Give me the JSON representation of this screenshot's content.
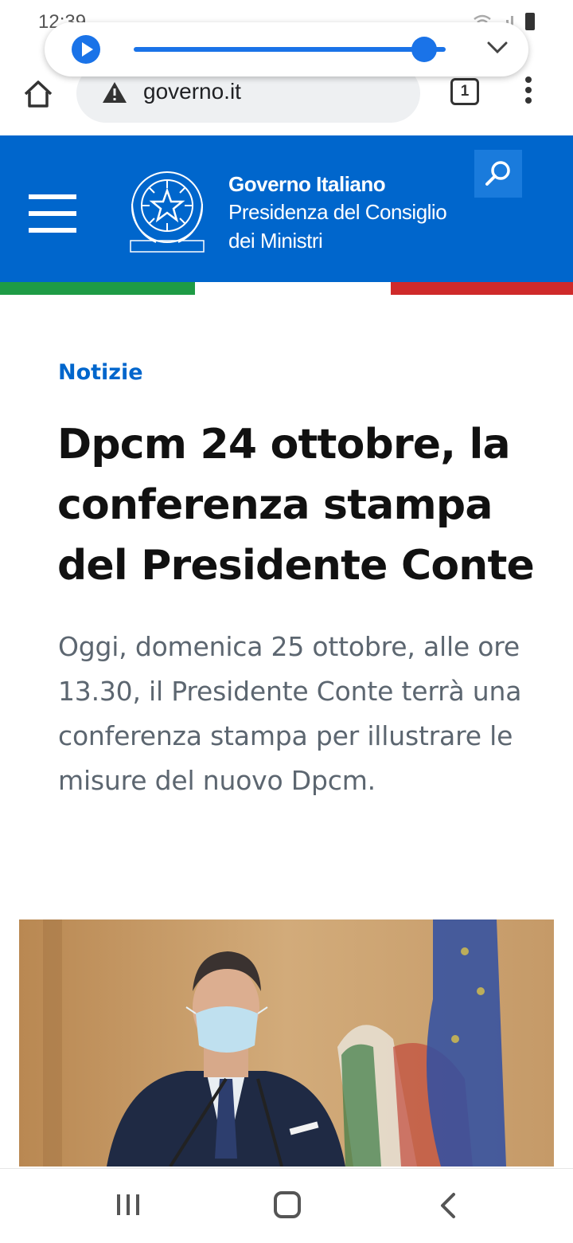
{
  "status_bar": {
    "time": "12:39",
    "icons": [
      "check-icon",
      "image-icon",
      "wifi-icon",
      "volte-icon",
      "signal-icon",
      "battery-icon"
    ]
  },
  "media_player": {
    "progress_fraction": 0.93,
    "play_icon": "play-icon",
    "collapse_icon": "chevron-down-icon"
  },
  "browser": {
    "url": "governo.it",
    "tab_count": "1",
    "security_icon": "warning-icon"
  },
  "site_header": {
    "brand_title": "Governo Italiano",
    "brand_sub_1": "Presidenza del Consiglio",
    "brand_sub_2": "dei Ministri",
    "emblem_text": "REPVBBLICA ITALIANA",
    "colors": {
      "header_bg": "#0066cc",
      "green": "#1e9b45",
      "red": "#cf2a2a"
    }
  },
  "article": {
    "category": "Notizie",
    "headline": "Dpcm 24 ottobre, la conferenza stampa del Presidente Conte",
    "lead": "Oggi, domenica 25 ottobre, alle ore 13.30, il Presidente Conte terrà una conferenza stampa per illustrare le misure del nuovo Dpcm."
  },
  "nav_bar": {
    "icons": [
      "recent-apps-icon",
      "home-icon",
      "back-icon"
    ]
  }
}
